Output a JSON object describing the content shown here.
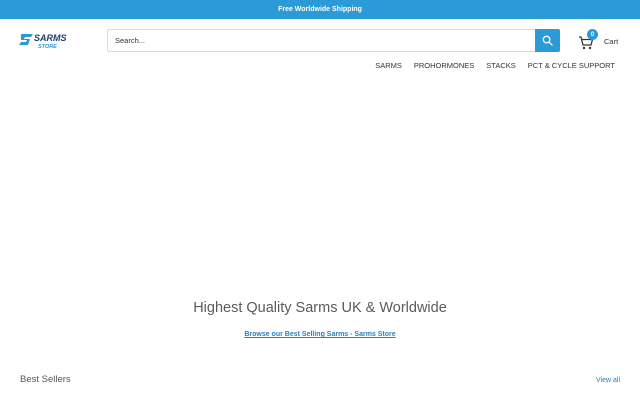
{
  "announcement": {
    "text": "Free Worldwide Shipping"
  },
  "brand": {
    "logo_main": "SARMS",
    "logo_sub": "STORE",
    "accent": "#2c9ad6"
  },
  "search": {
    "placeholder": "Search...",
    "icon": "search-icon"
  },
  "cart": {
    "count": "0",
    "label": "Cart",
    "icon": "cart-icon"
  },
  "nav": {
    "items": [
      "SARMS",
      "PROHORMONES",
      "STACKS",
      "PCT & CYCLE SUPPORT"
    ]
  },
  "hero": {
    "title": "Highest Quality Sarms UK & Worldwide",
    "link": "Browse our Best Selling Sarms - Sarms Store"
  },
  "best_sellers": {
    "title": "Best Sellers",
    "view_all": "View all"
  }
}
